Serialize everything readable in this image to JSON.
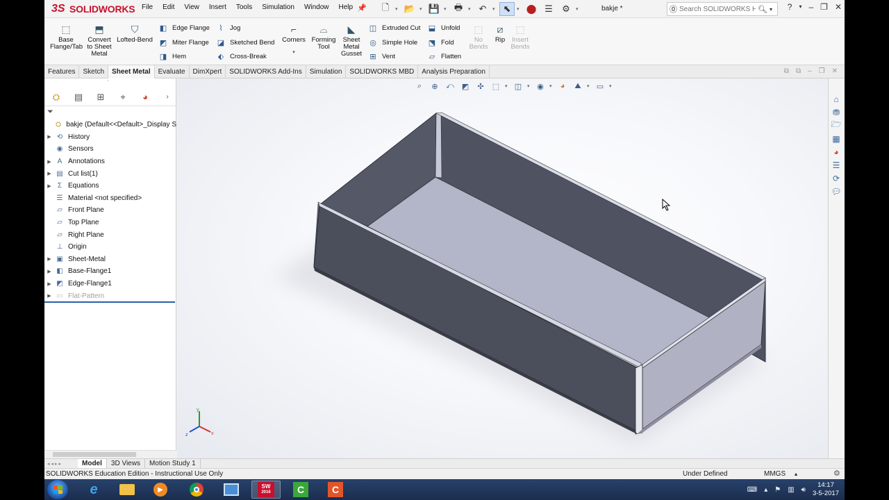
{
  "app": {
    "brand": "SOLIDWORKS",
    "doc_title": "bakje *",
    "menus": [
      "File",
      "Edit",
      "View",
      "Insert",
      "Tools",
      "Simulation",
      "Window",
      "Help"
    ],
    "search_placeholder": "Search SOLIDWORKS Help"
  },
  "ribbon": {
    "base_flange": "Base\nFlange/Tab",
    "convert": "Convert\nto Sheet\nMetal",
    "lofted": "Lofted-Bend",
    "edge_flange": "Edge Flange",
    "miter_flange": "Miter Flange",
    "hem": "Hem",
    "jog": "Jog",
    "sketched_bend": "Sketched Bend",
    "cross_break": "Cross-Break",
    "corners": "Corners",
    "forming_tool": "Forming\nTool",
    "gusset": "Sheet\nMetal\nGusset",
    "extruded_cut": "Extruded Cut",
    "simple_hole": "Simple Hole",
    "vent": "Vent",
    "unfold": "Unfold",
    "fold": "Fold",
    "flatten": "Flatten",
    "no_bends": "No\nBends",
    "rip": "Rip",
    "insert_bends": "Insert\nBends"
  },
  "cm_tabs": [
    "Features",
    "Sketch",
    "Sheet Metal",
    "Evaluate",
    "DimXpert",
    "SOLIDWORKS Add-Ins",
    "Simulation",
    "SOLIDWORKS MBD",
    "Analysis Preparation"
  ],
  "cm_active": "Sheet Metal",
  "tree": {
    "root": "bakje  (Default<<Default>_Display S",
    "items": [
      {
        "label": "History",
        "expand": true,
        "icon": "history-icon"
      },
      {
        "label": "Sensors",
        "expand": false,
        "icon": "sensor-icon"
      },
      {
        "label": "Annotations",
        "expand": true,
        "icon": "annotation-icon"
      },
      {
        "label": "Cut list(1)",
        "expand": true,
        "icon": "cutlist-icon"
      },
      {
        "label": "Equations",
        "expand": true,
        "icon": "equation-icon"
      },
      {
        "label": "Material <not specified>",
        "expand": false,
        "icon": "material-icon"
      },
      {
        "label": "Front Plane",
        "expand": false,
        "icon": "plane-icon"
      },
      {
        "label": "Top Plane",
        "expand": false,
        "icon": "plane-icon"
      },
      {
        "label": "Right Plane",
        "expand": false,
        "icon": "plane-icon"
      },
      {
        "label": "Origin",
        "expand": false,
        "icon": "origin-icon"
      },
      {
        "label": "Sheet-Metal",
        "expand": true,
        "icon": "sheetmetal-icon"
      },
      {
        "label": "Base-Flange1",
        "expand": true,
        "icon": "baseflange-icon"
      },
      {
        "label": "Edge-Flange1",
        "expand": true,
        "icon": "edgeflange-icon"
      },
      {
        "label": "Flat-Pattern",
        "expand": true,
        "icon": "flatpattern-icon",
        "dim": true
      }
    ]
  },
  "bottom_tabs": [
    "Model",
    "3D Views",
    "Motion Study 1"
  ],
  "bottom_active": "Model",
  "status": {
    "left": "SOLIDWORKS Education Edition - Instructional Use Only",
    "state": "Under Defined",
    "units": "MMGS"
  },
  "taskbar": {
    "sw_badge": "2016",
    "time": "14:17",
    "date": "3-5-2017"
  },
  "colors": {
    "sw_red": "#c8102e",
    "model_face_dark": "#4f5260",
    "model_face_light": "#b3b5c8",
    "rollback_bar": "#2c5ea8"
  }
}
